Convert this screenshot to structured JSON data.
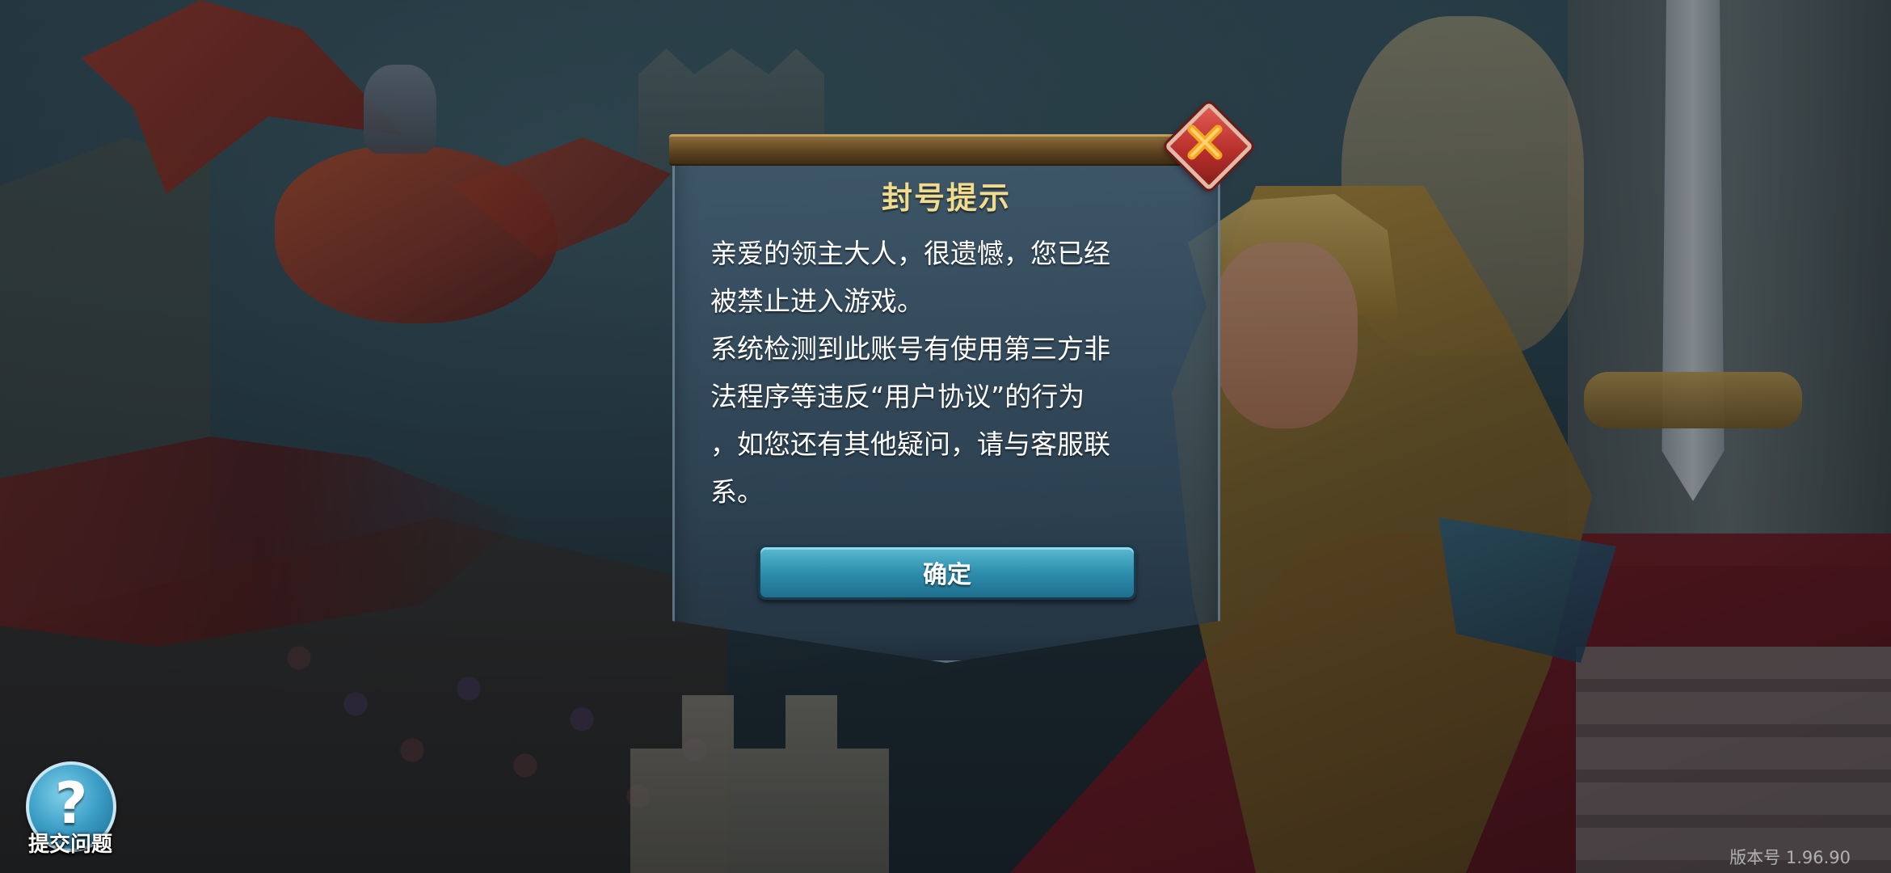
{
  "dialog": {
    "title": "封号提示",
    "message_lines": [
      "亲爱的领主大人，很遗憾，您已经",
      "被禁止进入游戏。",
      "系统检测到此账号有使用第三方非",
      "法程序等违反“用户协议”的行为",
      "，如您还有其他疑问，请与客服联",
      "系。"
    ],
    "confirm_label": "确定",
    "close_icon": "close-icon"
  },
  "help": {
    "icon": "question-icon",
    "label": "提交问题"
  },
  "footer": {
    "version": "版本号 1.96.90"
  },
  "colors": {
    "title": "#f0dc8c",
    "confirm_button": "#2e8fae",
    "close_button": "#b8302c",
    "close_x": "#f5a623"
  }
}
